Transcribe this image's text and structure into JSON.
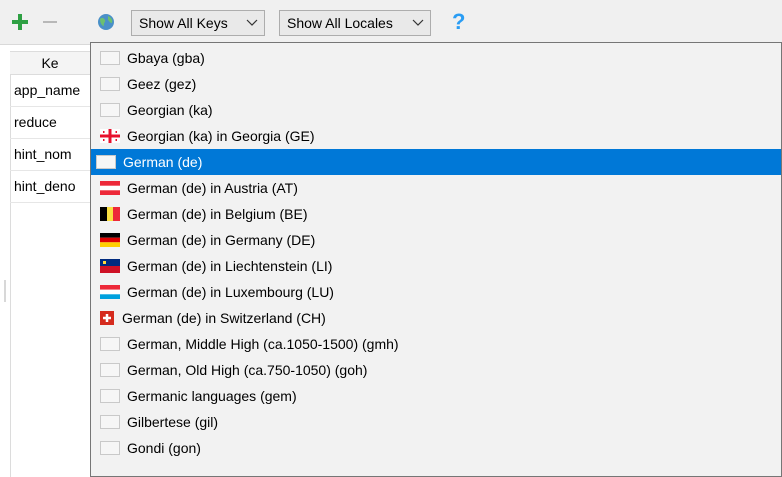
{
  "toolbar": {
    "add_icon": "plus-icon",
    "remove_icon": "minus-icon",
    "locale_icon": "globe-icon",
    "keys_filter": {
      "value": "Show All Keys"
    },
    "locales_filter": {
      "value": "Show All Locales"
    },
    "help_label": "?"
  },
  "table": {
    "header_key": "Ke",
    "rows": [
      "app_name",
      "reduce",
      "hint_nom",
      "hint_deno"
    ]
  },
  "locale_dropdown": {
    "selected": "German (de)",
    "items": [
      {
        "label": "Gbaya (gba)",
        "flag": "blank"
      },
      {
        "label": "Geez (gez)",
        "flag": "blank"
      },
      {
        "label": "Georgian (ka)",
        "flag": "blank"
      },
      {
        "label": "Georgian (ka) in Georgia (GE)",
        "flag": "georgia-flag"
      },
      {
        "label": "German (de)",
        "flag": "blank",
        "selected": true
      },
      {
        "label": "German (de) in Austria (AT)",
        "flag": "austria-flag"
      },
      {
        "label": "German (de) in Belgium (BE)",
        "flag": "belgium-flag"
      },
      {
        "label": "German (de) in Germany (DE)",
        "flag": "germany-flag"
      },
      {
        "label": "German (de) in Liechtenstein (LI)",
        "flag": "liechtenstein-flag"
      },
      {
        "label": "German (de) in Luxembourg (LU)",
        "flag": "luxembourg-flag"
      },
      {
        "label": "German (de) in Switzerland (CH)",
        "flag": "switzerland-flag"
      },
      {
        "label": "German, Middle High (ca.1050-1500) (gmh)",
        "flag": "blank"
      },
      {
        "label": "German, Old High (ca.750-1050) (goh)",
        "flag": "blank"
      },
      {
        "label": "Germanic languages (gem)",
        "flag": "blank"
      },
      {
        "label": "Gilbertese (gil)",
        "flag": "blank"
      },
      {
        "label": "Gondi (gon)",
        "flag": "blank"
      }
    ]
  },
  "colors": {
    "selection": "#0078d7",
    "add_green": "#2ea043",
    "help_blue": "#2a9df4"
  }
}
